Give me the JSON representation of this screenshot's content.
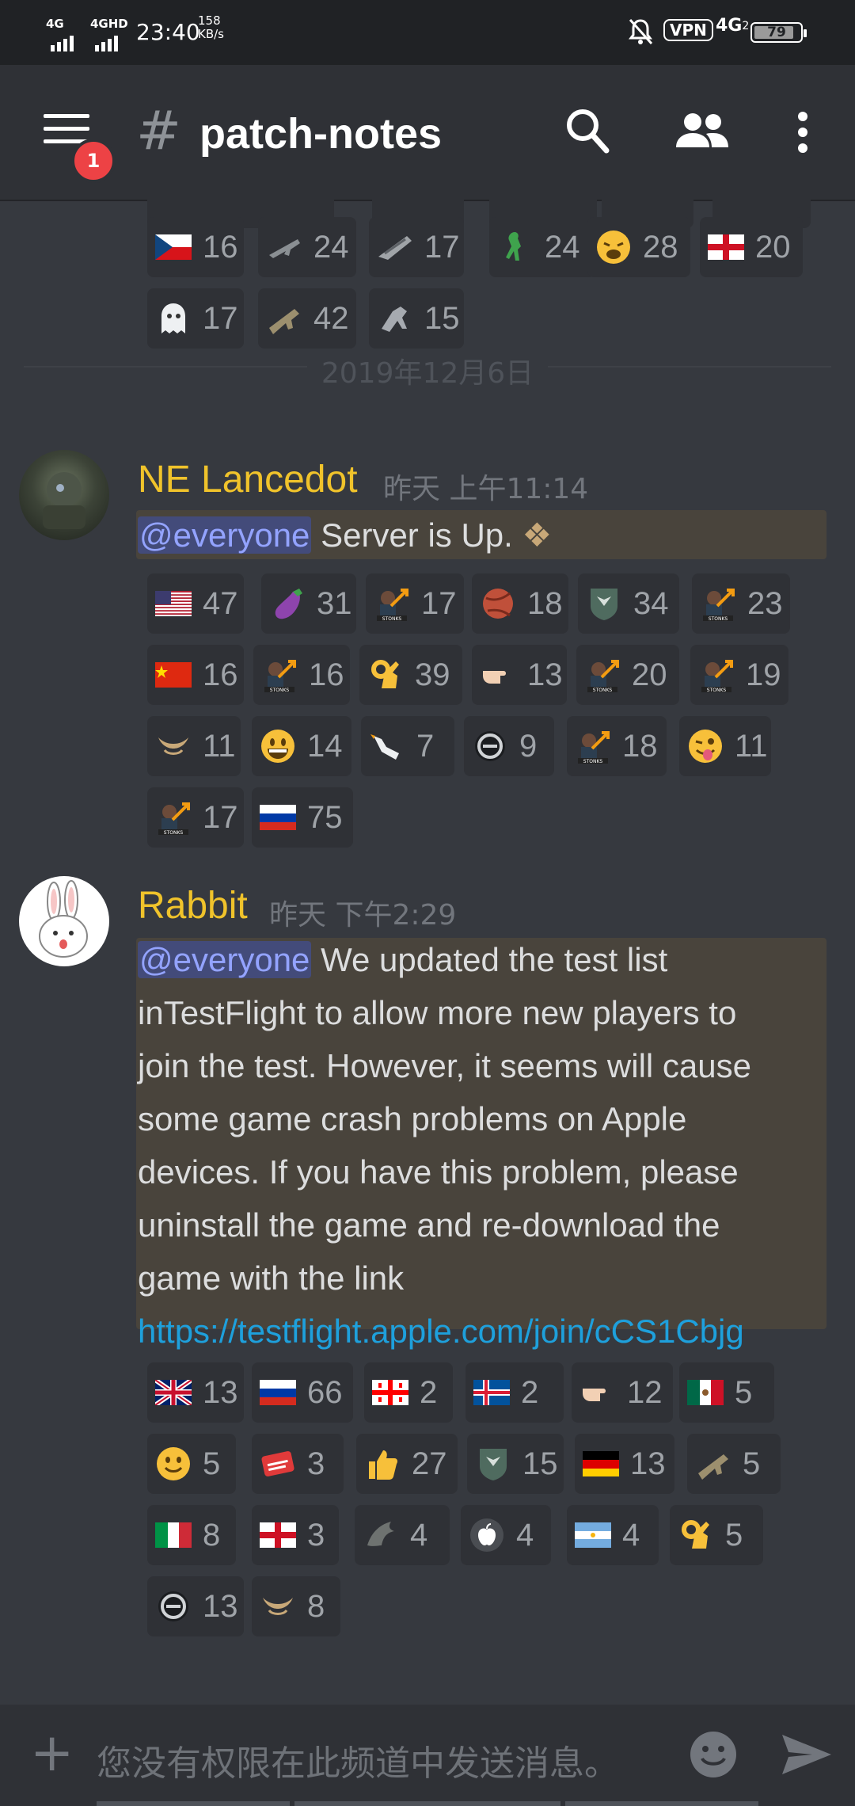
{
  "status_bar": {
    "net1": "4G",
    "net2": "4GHD",
    "time": "23:40",
    "speed_value": "158",
    "speed_unit": "KB/s",
    "vpn": "VPN",
    "net3": "4G",
    "sim": "2",
    "battery": "79"
  },
  "header": {
    "hash": "#",
    "channel": "patch-notes",
    "badge": "1"
  },
  "date_divider": "2019年12月6日",
  "top_reactions": [
    {
      "icon": "czech-flag",
      "count": "16"
    },
    {
      "icon": "rifle-icon",
      "count": "24"
    },
    {
      "icon": "ship-icon",
      "count": "17"
    },
    {
      "icon": "lizard-icon",
      "count": "24"
    },
    {
      "icon": "weary-face",
      "count": "28"
    },
    {
      "icon": "england-flag",
      "count": "20"
    },
    {
      "icon": "ghost-icon",
      "count": "17"
    },
    {
      "icon": "cannon-icon",
      "count": "42"
    },
    {
      "icon": "mech-icon",
      "count": "15"
    }
  ],
  "messages": [
    {
      "author": "NE Lancedot",
      "timestamp": "昨天 上午11:14",
      "mention": "@everyone",
      "text": "Server is Up.",
      "reactions": [
        {
          "icon": "us-flag",
          "count": "47"
        },
        {
          "icon": "eggplant",
          "count": "31"
        },
        {
          "icon": "stonks",
          "count": "17"
        },
        {
          "icon": "ball-icon",
          "count": "18"
        },
        {
          "icon": "eagle-shield",
          "count": "34"
        },
        {
          "icon": "stonks",
          "count": "23"
        },
        {
          "icon": "china-flag",
          "count": "16"
        },
        {
          "icon": "stonks",
          "count": "16"
        },
        {
          "icon": "ok-hand",
          "count": "39"
        },
        {
          "icon": "pointing-hand",
          "count": "13"
        },
        {
          "icon": "stonks",
          "count": "20"
        },
        {
          "icon": "stonks",
          "count": "19"
        },
        {
          "icon": "horns-icon",
          "count": "11"
        },
        {
          "icon": "grinning-face",
          "count": "14"
        },
        {
          "icon": "goose-icon",
          "count": "7"
        },
        {
          "icon": "ring-logo",
          "count": "9"
        },
        {
          "icon": "stonks",
          "count": "18"
        },
        {
          "icon": "winking-tongue-face",
          "count": "11"
        },
        {
          "icon": "stonks",
          "count": "17"
        },
        {
          "icon": "russia-flag",
          "count": "75"
        }
      ]
    },
    {
      "author": "Rabbit",
      "timestamp": "昨天 下午2:29",
      "mention": "@everyone",
      "lines": [
        "We updated the test list",
        "inTestFlight to allow more new players to",
        "join the test.  However, it seems will cause",
        "some game crash problems on Apple",
        "devices. If you have this problem, please",
        "uninstall the game and re-download the",
        "game with the link"
      ],
      "link": "https://testflight.apple.com/join/cCS1Cbjg",
      "reactions": [
        {
          "icon": "uk-flag",
          "count": "13"
        },
        {
          "icon": "russia-flag",
          "count": "66"
        },
        {
          "icon": "georgia-flag",
          "count": "2"
        },
        {
          "icon": "iceland-flag",
          "count": "2"
        },
        {
          "icon": "pointing-hand",
          "count": "12"
        },
        {
          "icon": "mexico-flag",
          "count": "5"
        },
        {
          "icon": "slight-smile",
          "count": "5"
        },
        {
          "icon": "get-fucked-sticker",
          "count": "3"
        },
        {
          "icon": "thumbs-up",
          "count": "27"
        },
        {
          "icon": "eagle-shield",
          "count": "15"
        },
        {
          "icon": "germany-flag",
          "count": "13"
        },
        {
          "icon": "cannon-icon",
          "count": "5"
        },
        {
          "icon": "italy-flag",
          "count": "8"
        },
        {
          "icon": "england-flag",
          "count": "3"
        },
        {
          "icon": "dragon-icon",
          "count": "4"
        },
        {
          "icon": "apple-icon",
          "count": "4"
        },
        {
          "icon": "argentina-flag",
          "count": "4"
        },
        {
          "icon": "ok-hand",
          "count": "5"
        },
        {
          "icon": "ring-logo",
          "count": "13"
        },
        {
          "icon": "horns-icon",
          "count": "8"
        }
      ]
    }
  ],
  "input": {
    "plus": "+",
    "placeholder": "您没有权限在此频道中发送消息。"
  },
  "colors": {
    "background": "#36393f",
    "header": "#2f3136",
    "author": "#f0c32b",
    "mention_bg": "#434b7a",
    "highlight_bg": "#49443c",
    "link": "#1ea0dc"
  }
}
